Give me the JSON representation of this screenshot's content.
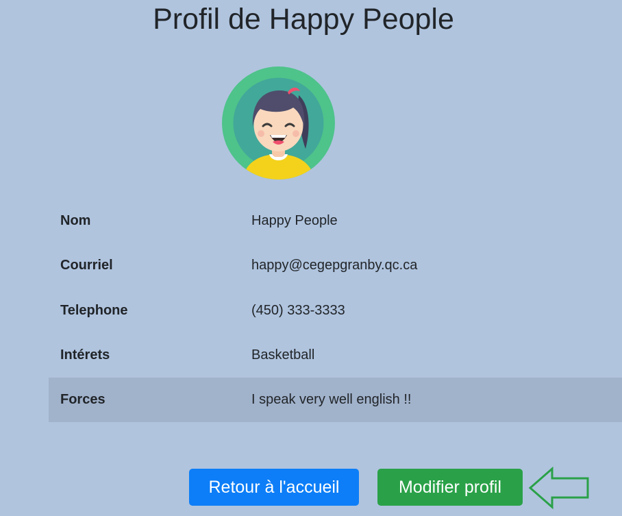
{
  "page": {
    "title": "Profil de Happy People"
  },
  "profile": {
    "avatar_icon": "girl-avatar-icon",
    "rows": [
      {
        "label": "Nom",
        "value": "Happy People"
      },
      {
        "label": "Courriel",
        "value": "happy@cegepgranby.qc.ca"
      },
      {
        "label": "Telephone",
        "value": "(450) 333-3333"
      },
      {
        "label": "Intérets",
        "value": "Basketball"
      },
      {
        "label": "Forces",
        "value": "I speak very well english !!"
      }
    ]
  },
  "actions": {
    "home_label": "Retour à l'accueil",
    "edit_label": "Modifier profil",
    "pointer_icon": "left-arrow-icon"
  },
  "colors": {
    "background": "#b0c4de",
    "highlight_row": "#a1b2cb",
    "primary_button": "#0d7ef7",
    "success_button": "#2aa148",
    "arrow_outline": "#2aa148"
  }
}
